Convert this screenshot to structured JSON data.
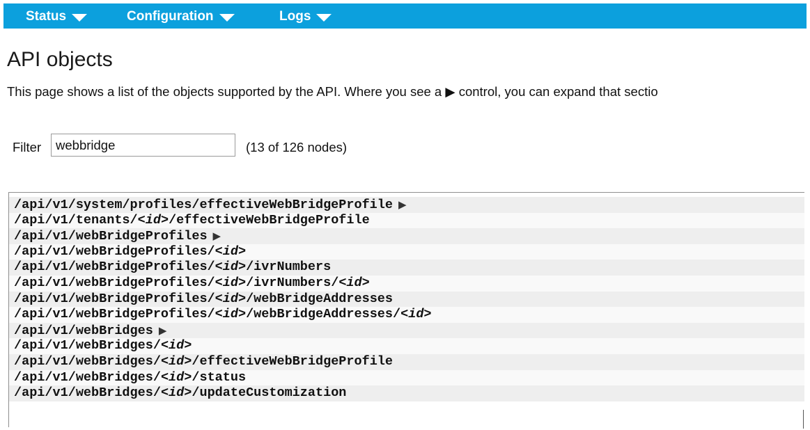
{
  "nav": {
    "items": [
      {
        "label": "Status"
      },
      {
        "label": "Configuration"
      },
      {
        "label": "Logs"
      }
    ],
    "color": "#0ca0dd"
  },
  "page": {
    "title": "API objects",
    "description": "This page shows a list of the objects supported by the API. Where you see a ▶ control, you can expand that sectio"
  },
  "filter": {
    "label": "Filter",
    "value": "webbridge",
    "count_text": "(13 of 126 nodes)"
  },
  "list": {
    "expand_glyph": "▶",
    "rows": [
      {
        "parts": [
          "/api/v1/system/profiles/effectiveWebBridgeProfile"
        ],
        "expandable": true
      },
      {
        "parts": [
          "/api/v1/tenants/",
          "<id>",
          "/effectiveWebBridgeProfile"
        ],
        "expandable": false
      },
      {
        "parts": [
          "/api/v1/webBridgeProfiles"
        ],
        "expandable": true
      },
      {
        "parts": [
          "/api/v1/webBridgeProfiles/",
          "<id>"
        ],
        "expandable": false
      },
      {
        "parts": [
          "/api/v1/webBridgeProfiles/",
          "<id>",
          "/ivrNumbers"
        ],
        "expandable": false
      },
      {
        "parts": [
          "/api/v1/webBridgeProfiles/",
          "<id>",
          "/ivrNumbers/",
          "<id>"
        ],
        "expandable": false
      },
      {
        "parts": [
          "/api/v1/webBridgeProfiles/",
          "<id>",
          "/webBridgeAddresses"
        ],
        "expandable": false
      },
      {
        "parts": [
          "/api/v1/webBridgeProfiles/",
          "<id>",
          "/webBridgeAddresses/",
          "<id>"
        ],
        "expandable": false
      },
      {
        "parts": [
          "/api/v1/webBridges"
        ],
        "expandable": true
      },
      {
        "parts": [
          "/api/v1/webBridges/",
          "<id>"
        ],
        "expandable": false
      },
      {
        "parts": [
          "/api/v1/webBridges/",
          "<id>",
          "/effectiveWebBridgeProfile"
        ],
        "expandable": false
      },
      {
        "parts": [
          "/api/v1/webBridges/",
          "<id>",
          "/status"
        ],
        "expandable": false
      },
      {
        "parts": [
          "/api/v1/webBridges/",
          "<id>",
          "/updateCustomization"
        ],
        "expandable": false
      }
    ]
  }
}
